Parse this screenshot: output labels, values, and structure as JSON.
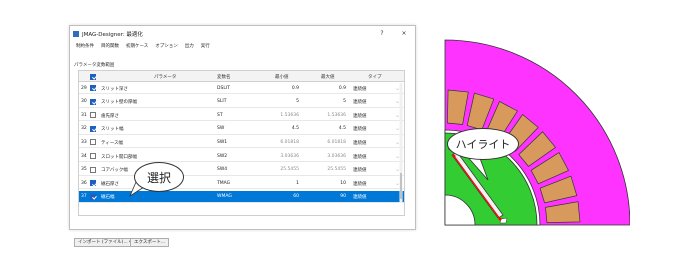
{
  "window": {
    "title": "JMAG-Designer: 最適化",
    "help_btn": "?",
    "close_btn": "×"
  },
  "menu": [
    "制約条件",
    "目的関数",
    "初期ケース",
    "オプション",
    "出力",
    "実行"
  ],
  "group_label": "パラメータ変数範囲",
  "table": {
    "headers": [
      "パラメータ",
      "変数名",
      "最小値",
      "最大値",
      "タイプ"
    ],
    "rows": [
      {
        "num": "29",
        "checked": true,
        "param": "スリット深さ",
        "var": "DSLIT",
        "min": "0.9",
        "max": "0.9",
        "type": "連続値",
        "enabled": true
      },
      {
        "num": "30",
        "checked": true,
        "param": "スリット壁の厚幅",
        "var": "SLIT",
        "min": "5",
        "max": "5",
        "type": "連続値",
        "enabled": true
      },
      {
        "num": "31",
        "checked": false,
        "param": "歯先厚さ",
        "var": "ST",
        "min": "1.53636",
        "max": "1.53636",
        "type": "連続値",
        "enabled": false
      },
      {
        "num": "32",
        "checked": true,
        "param": "スリット幅",
        "var": "SW",
        "min": "4.5",
        "max": "4.5",
        "type": "連続値",
        "enabled": true
      },
      {
        "num": "33",
        "checked": false,
        "param": "ティース幅",
        "var": "SW1",
        "min": "6.01818",
        "max": "6.01818",
        "type": "連続値",
        "enabled": false
      },
      {
        "num": "34",
        "checked": false,
        "param": "スロット開口部幅",
        "var": "SW2",
        "min": "3.03636",
        "max": "3.03636",
        "type": "連続値",
        "enabled": false
      },
      {
        "num": "35",
        "checked": false,
        "param": "コアバック幅",
        "var": "SW4",
        "min": "25.5455",
        "max": "25.5455",
        "type": "連続値",
        "enabled": false
      },
      {
        "num": "36",
        "checked": true,
        "param": "磁石厚さ",
        "var": "TMAG",
        "min": "1",
        "max": "10",
        "type": "連続値",
        "enabled": true
      },
      {
        "num": "37",
        "checked": true,
        "param": "磁石幅",
        "var": "WMAG",
        "min": "60",
        "max": "90",
        "type": "連続値",
        "enabled": true,
        "selected": true
      }
    ]
  },
  "buttons": {
    "import": "インポート (ファイル)... ▾",
    "export": "エクスポート..."
  },
  "callouts": {
    "select": "選択",
    "highlight": "ハイライト"
  },
  "colors": {
    "selection": "#0078d7",
    "magenta_core": "#ff33ff",
    "rotor_green": "#33cc33",
    "coil_brown": "#d89a5c"
  }
}
